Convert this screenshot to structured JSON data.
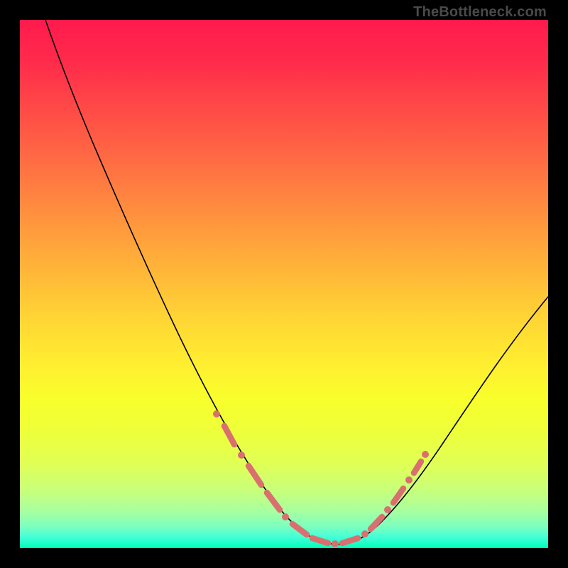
{
  "watermark": "TheBottleneck.com",
  "colors": {
    "page_bg": "#000000",
    "curve": "#000000",
    "marker": "#d9706f",
    "gradient_top": "#ff1a4d",
    "gradient_bottom": "#00ffb8"
  },
  "chart_data": {
    "type": "line",
    "title": "",
    "xlabel": "",
    "ylabel": "",
    "xlim": [
      0,
      100
    ],
    "ylim": [
      0,
      100
    ],
    "grid": false,
    "legend": false,
    "series": [
      {
        "name": "curve",
        "x": [
          5,
          8,
          12,
          16,
          20,
          24,
          28,
          32,
          36,
          40,
          44,
          48,
          51,
          54,
          56,
          58,
          60,
          63,
          66,
          70,
          74,
          78,
          82,
          86,
          90,
          94,
          98,
          100
        ],
        "y": [
          100,
          93,
          85,
          77,
          69,
          61,
          53,
          45,
          38,
          31,
          24,
          17,
          12,
          8,
          5,
          3,
          2,
          2,
          3,
          6,
          11,
          17,
          24,
          31,
          38,
          45,
          51,
          55
        ]
      }
    ],
    "highlight_points": {
      "comment": "pink dot/segment markers near the valley of the curve",
      "x": [
        37,
        40,
        43,
        46,
        49,
        52,
        55,
        57,
        59,
        61,
        63,
        66,
        68,
        70
      ],
      "y": [
        24,
        20,
        16,
        12,
        9,
        6,
        4,
        3,
        2,
        2,
        3,
        5,
        8,
        12
      ]
    }
  }
}
